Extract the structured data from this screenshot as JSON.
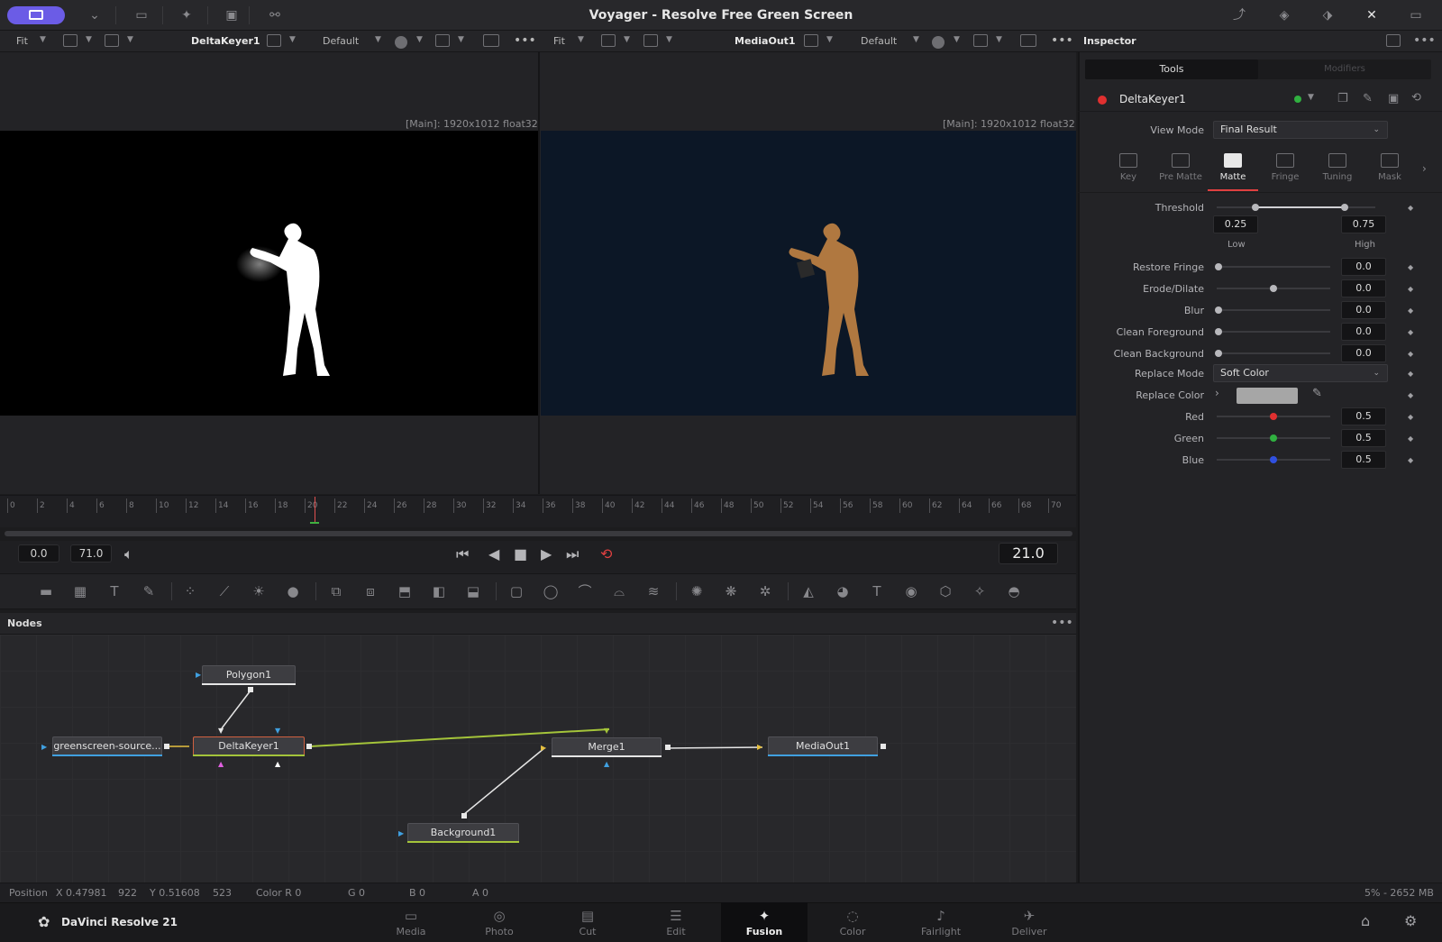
{
  "window": {
    "title": "Voyager - Resolve Free Green Screen"
  },
  "viewer_left": {
    "fit": "Fit",
    "node": "DeltaKeyer1",
    "lut": "Default",
    "resolution": "[Main]: 1920x1012 float32"
  },
  "viewer_right": {
    "fit": "Fit",
    "node": "MediaOut1",
    "lut": "Default",
    "resolution": "[Main]: 1920x1012 float32"
  },
  "timeline": {
    "ticks": [
      "0",
      "2",
      "4",
      "6",
      "8",
      "10",
      "12",
      "14",
      "16",
      "18",
      "20",
      "22",
      "24",
      "26",
      "28",
      "30",
      "32",
      "34",
      "36",
      "38",
      "40",
      "42",
      "44",
      "46",
      "48",
      "50",
      "52",
      "54",
      "56",
      "58",
      "60",
      "62",
      "64",
      "66",
      "68",
      "70"
    ],
    "current_frame": 21.0
  },
  "transport": {
    "start": "0.0",
    "end": "71.0",
    "current": "21.0"
  },
  "nodes": {
    "header": "Nodes",
    "items": {
      "polygon": "Polygon1",
      "source": "greenscreen-source...",
      "keyer": "DeltaKeyer1",
      "merge": "Merge1",
      "mediaout": "MediaOut1",
      "background": "Background1"
    }
  },
  "status": {
    "position_label": "Position",
    "x": "X 0.47981",
    "x_px": "922",
    "y": "Y 0.51608",
    "y_px": "523",
    "color_r": "Color R 0",
    "g": "G 0",
    "b": "B 0",
    "a": "A 0",
    "memory": "5% - 2652 MB"
  },
  "pages": {
    "brand": "DaVinci Resolve 21",
    "tabs": [
      "Media",
      "Photo",
      "Cut",
      "Edit",
      "Fusion",
      "Color",
      "Fairlight",
      "Deliver"
    ],
    "active": "Fusion"
  },
  "inspector": {
    "title": "Inspector",
    "tab_tools": "Tools",
    "tab_modifiers": "Modifiers",
    "tool_name": "DeltaKeyer1",
    "view_mode_label": "View Mode",
    "view_mode_value": "Final Result",
    "subtabs": [
      "Key",
      "Pre Matte",
      "Matte",
      "Fringe",
      "Tuning",
      "Mask"
    ],
    "active_subtab": "Matte",
    "threshold": {
      "label": "Threshold",
      "low": "0.25",
      "high": "0.75",
      "low_label": "Low",
      "high_label": "High"
    },
    "sliders": [
      {
        "label": "Restore Fringe",
        "value": "0.0",
        "knob": 0.0
      },
      {
        "label": "Erode/Dilate",
        "value": "0.0",
        "knob": 0.5
      },
      {
        "label": "Blur",
        "value": "0.0",
        "knob": 0.0
      },
      {
        "label": "Clean Foreground",
        "value": "0.0",
        "knob": 0.0
      },
      {
        "label": "Clean Background",
        "value": "0.0",
        "knob": 0.0
      }
    ],
    "replace_mode_label": "Replace Mode",
    "replace_mode_value": "Soft Color",
    "replace_color_label": "Replace Color",
    "replace_color_swatch": "#a6a6a6",
    "rgb": [
      {
        "label": "Red",
        "value": "0.5",
        "color": "#e03030"
      },
      {
        "label": "Green",
        "value": "0.5",
        "color": "#30b040"
      },
      {
        "label": "Blue",
        "value": "0.5",
        "color": "#3050e0"
      }
    ]
  },
  "colors": {
    "accent": "#6b5ce6",
    "active_underline": "#e04040",
    "link": "#a4c43a"
  }
}
